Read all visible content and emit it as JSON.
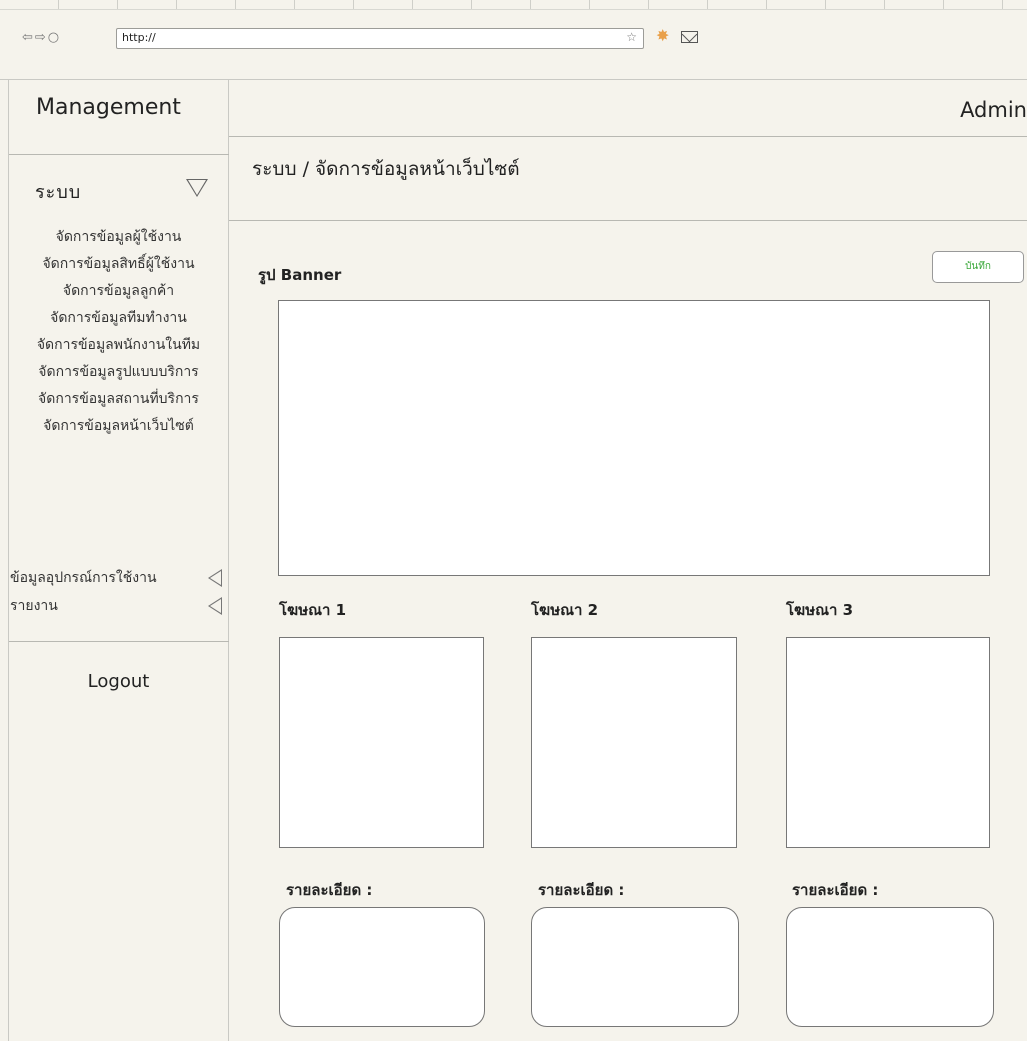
{
  "browser": {
    "nav_icons": "⇦⇨○",
    "url": "http://",
    "star": "☆"
  },
  "sidebar": {
    "title": "Management",
    "section_title": "ระบบ",
    "items": [
      "จัดการข้อมูลผู้ใช้งาน",
      "จัดการข้อมูลสิทธิ์ผู้ใช้งาน",
      "จัดการข้อมูลลูกค้า",
      "จัดการข้อมูลทีมทำงาน",
      "จัดการข้อมูลพนักงานในทีม",
      "จัดการข้อมูลรูปแบบบริการ",
      "จัดการข้อมูลสถานที่บริการ",
      "จัดการข้อมูลหน้าเว็บไซต์"
    ],
    "extra_items": [
      "ข้อมูลอุปกรณ์การใช้งาน",
      "รายงาน"
    ],
    "logout": "Logout"
  },
  "header": {
    "user": "Admin"
  },
  "breadcrumb": "ระบบ / จัดการข้อมูลหน้าเว็บไซต์",
  "form": {
    "banner_label": "รูป Banner",
    "save_label": "บันทึก",
    "ads": [
      {
        "label": "โฆษณา 1",
        "detail_label": "รายละเอียด :"
      },
      {
        "label": "โฆษณา 2",
        "detail_label": "รายละเอียด :"
      },
      {
        "label": "โฆษณา 3",
        "detail_label": "รายละเอียด :"
      }
    ]
  }
}
